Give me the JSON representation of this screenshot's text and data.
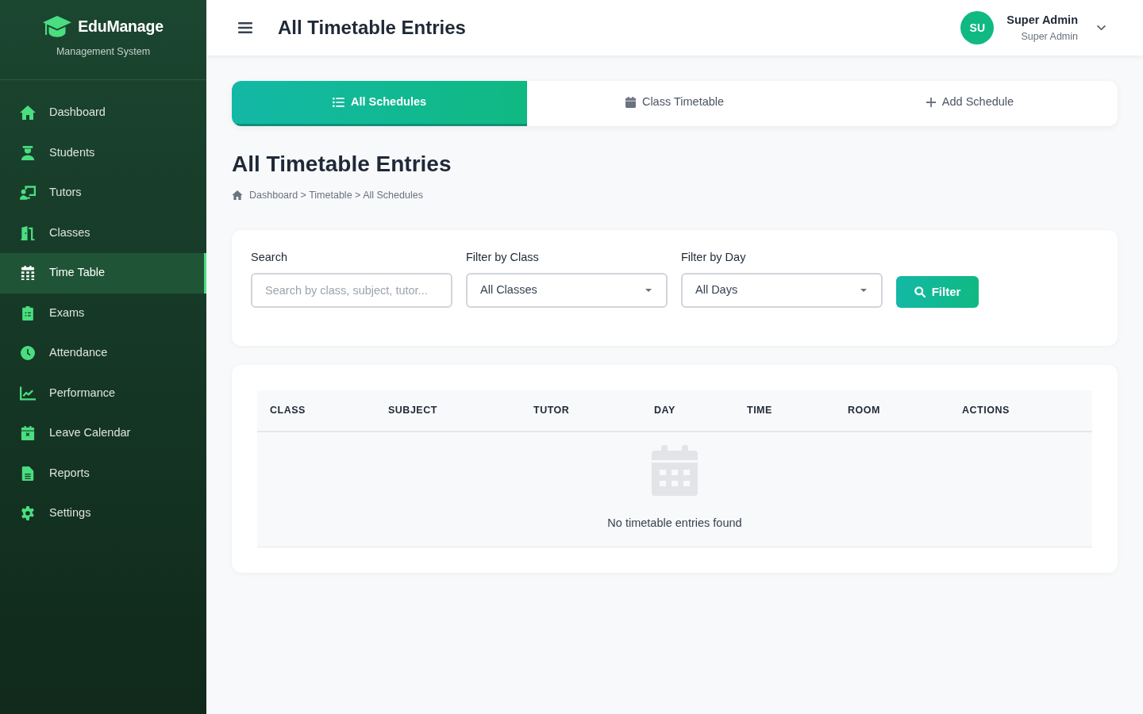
{
  "sidebar": {
    "brand": {
      "name": "EduManage",
      "subtitle": "Management System"
    },
    "items": [
      {
        "label": "Dashboard",
        "selected": false
      },
      {
        "label": "Students",
        "selected": false
      },
      {
        "label": "Tutors",
        "selected": false
      },
      {
        "label": "Classes",
        "selected": false
      },
      {
        "label": "Time Table",
        "selected": true
      },
      {
        "label": "Exams",
        "selected": false
      },
      {
        "label": "Attendance",
        "selected": false
      },
      {
        "label": "Performance",
        "selected": false
      },
      {
        "label": "Leave Calendar",
        "selected": false
      },
      {
        "label": "Reports",
        "selected": false
      },
      {
        "label": "Settings",
        "selected": false
      }
    ]
  },
  "header": {
    "title": "All Timetable Entries",
    "user": {
      "initials": "SU",
      "name": "Super Admin",
      "role": "Super Admin"
    }
  },
  "tabs": [
    {
      "label": "All Schedules",
      "selected": true
    },
    {
      "label": "Class Timetable",
      "selected": false
    },
    {
      "label": "Add Schedule",
      "selected": false
    }
  ],
  "page": {
    "title": "All Timetable Entries",
    "breadcrumb": "Dashboard > Timetable > All Schedules"
  },
  "filters": {
    "search": {
      "label": "Search",
      "placeholder": "Search by class, subject, tutor..."
    },
    "class_filter": {
      "label": "Filter by Class",
      "value": "All Classes"
    },
    "day_filter": {
      "label": "Filter by Day",
      "value": "All Days"
    },
    "button": "Filter"
  },
  "table": {
    "columns": [
      "CLASS",
      "SUBJECT",
      "TUTOR",
      "DAY",
      "TIME",
      "ROOM",
      "ACTIONS"
    ],
    "empty_message": "No timetable entries found"
  }
}
